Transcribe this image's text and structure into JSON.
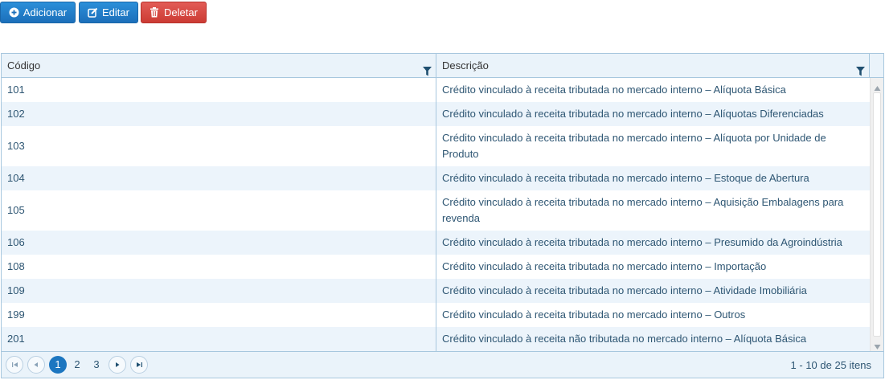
{
  "toolbar": {
    "add_label": "Adicionar",
    "edit_label": "Editar",
    "delete_label": "Deletar"
  },
  "grid": {
    "columns": [
      "Código",
      "Descrição"
    ],
    "rows": [
      {
        "code": "101",
        "desc": "Crédito vinculado à receita tributada no mercado interno – Alíquota Básica"
      },
      {
        "code": "102",
        "desc": "Crédito vinculado à receita tributada no mercado interno – Alíquotas Diferenciadas"
      },
      {
        "code": "103",
        "desc": "Crédito vinculado à receita tributada no mercado interno – Alíquota por Unidade de Produto"
      },
      {
        "code": "104",
        "desc": "Crédito vinculado à receita tributada no mercado interno – Estoque de Abertura"
      },
      {
        "code": "105",
        "desc": "Crédito vinculado à receita tributada no mercado interno – Aquisição Embalagens para revenda"
      },
      {
        "code": "106",
        "desc": "Crédito vinculado à receita tributada no mercado interno – Presumido da Agroindústria"
      },
      {
        "code": "108",
        "desc": "Crédito vinculado à receita tributada no mercado interno – Importação"
      },
      {
        "code": "109",
        "desc": "Crédito vinculado à receita tributada no mercado interno – Atividade Imobiliária"
      },
      {
        "code": "199",
        "desc": "Crédito vinculado à receita tributada no mercado interno – Outros"
      },
      {
        "code": "201",
        "desc": "Crédito vinculado à receita não tributada no mercado interno – Alíquota Básica"
      }
    ]
  },
  "pager": {
    "pages": [
      "1",
      "2",
      "3"
    ],
    "current_page": "1",
    "info": "1 - 10 de 25 itens"
  },
  "colors": {
    "primary": "#1c6fba",
    "danger": "#cc3b34",
    "header_bg": "#eaf3fa",
    "border": "#a7c7de",
    "text": "#2e5673"
  },
  "icons": {
    "add": "plus-circle-icon",
    "edit": "edit-icon",
    "delete": "trash-icon",
    "filter": "filter-icon"
  }
}
